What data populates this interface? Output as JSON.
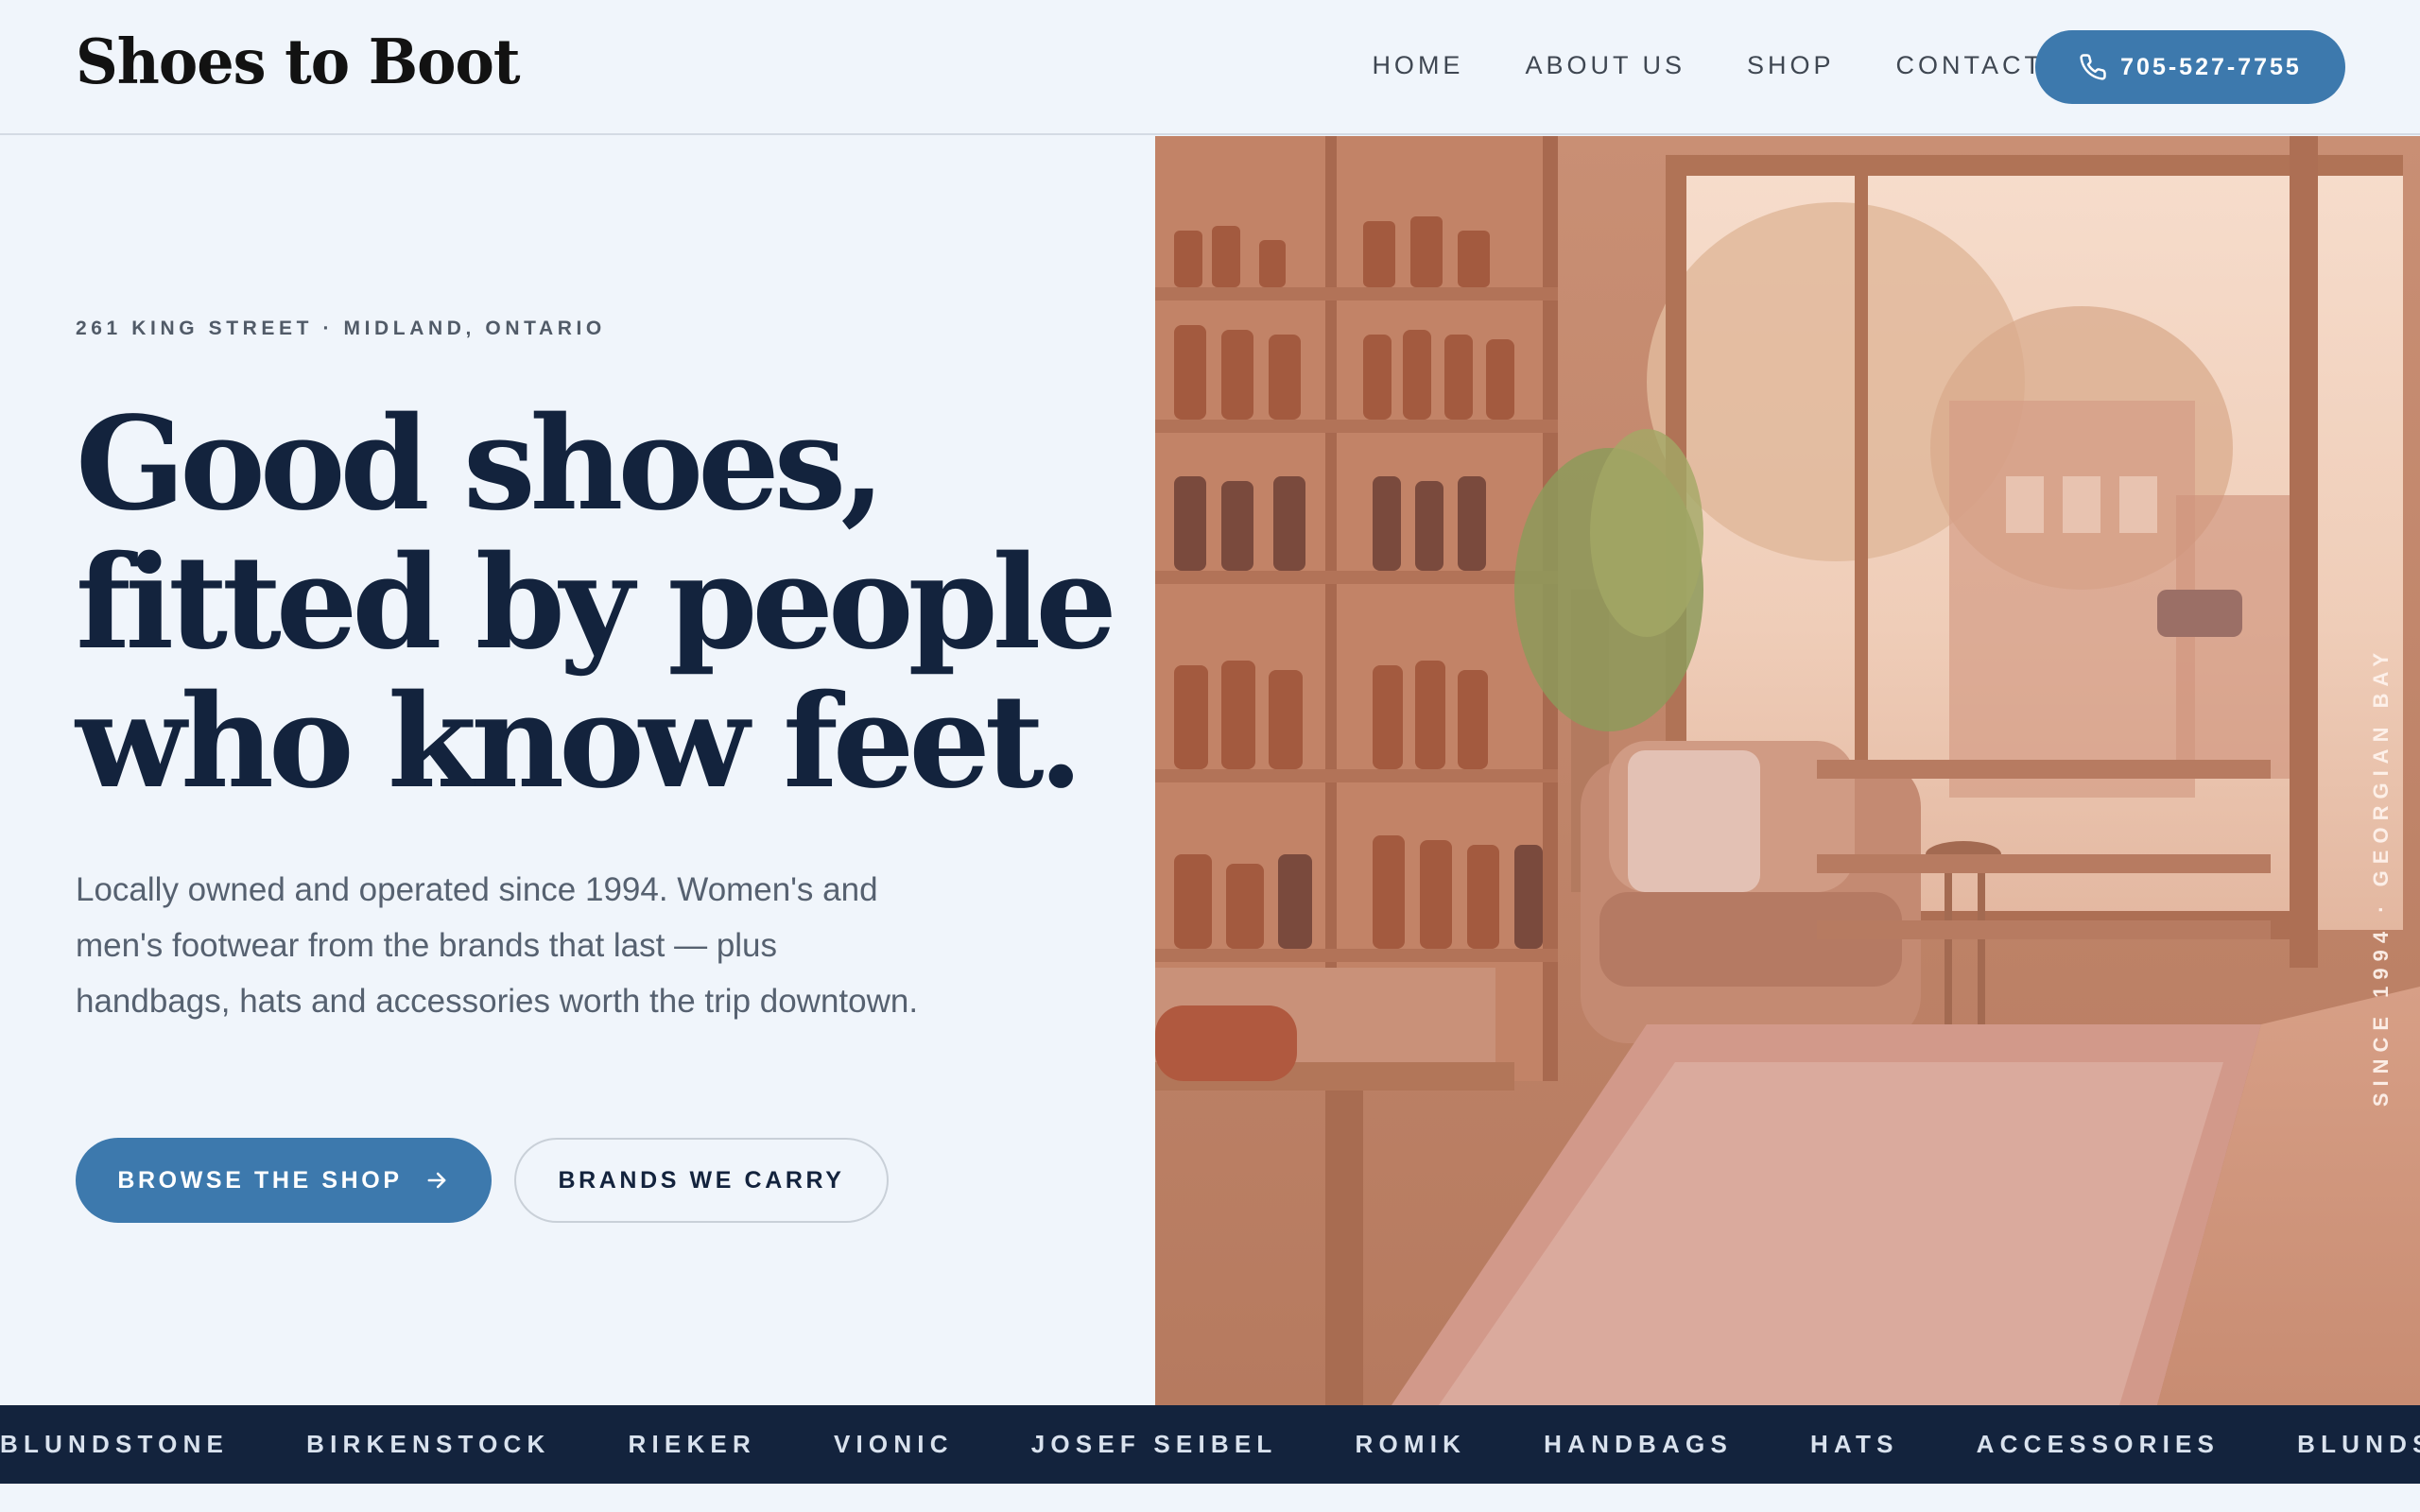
{
  "header": {
    "logo": "Shoes to Boot",
    "nav": [
      {
        "label": "HOME"
      },
      {
        "label": "ABOUT US"
      },
      {
        "label": "SHOP"
      },
      {
        "label": "CONTACT"
      }
    ],
    "phone": "705-527-7755"
  },
  "hero": {
    "eyebrow": "261 KING STREET · MIDLAND, ONTARIO",
    "headline_lines": [
      "Good shoes,",
      "fitted by people",
      "who know feet."
    ],
    "lede": "Locally owned and operated since 1994. Women's and men's footwear from the brands that last — plus handbags, hats and accessories worth the trip downtown.",
    "primary_cta": "BROWSE THE SHOP",
    "secondary_cta": "BRANDS WE CARRY",
    "image_tag": "SINCE 1994 · GEORGIAN BAY"
  },
  "marquee": {
    "items": [
      "BLUNDSTONE",
      "BIRKENSTOCK",
      "RIEKER",
      "VIONIC",
      "JOSEF SEIBEL",
      "ROMIK",
      "HANDBAGS",
      "HATS",
      "ACCESSORIES",
      "BLUNDSTONE"
    ]
  },
  "colors": {
    "background": "#f0f5fb",
    "navy": "#13233d",
    "accent_blue": "#3d79ad",
    "muted_text": "#566170"
  },
  "icons": {
    "phone": "phone-icon",
    "arrow": "arrow-right-icon"
  }
}
